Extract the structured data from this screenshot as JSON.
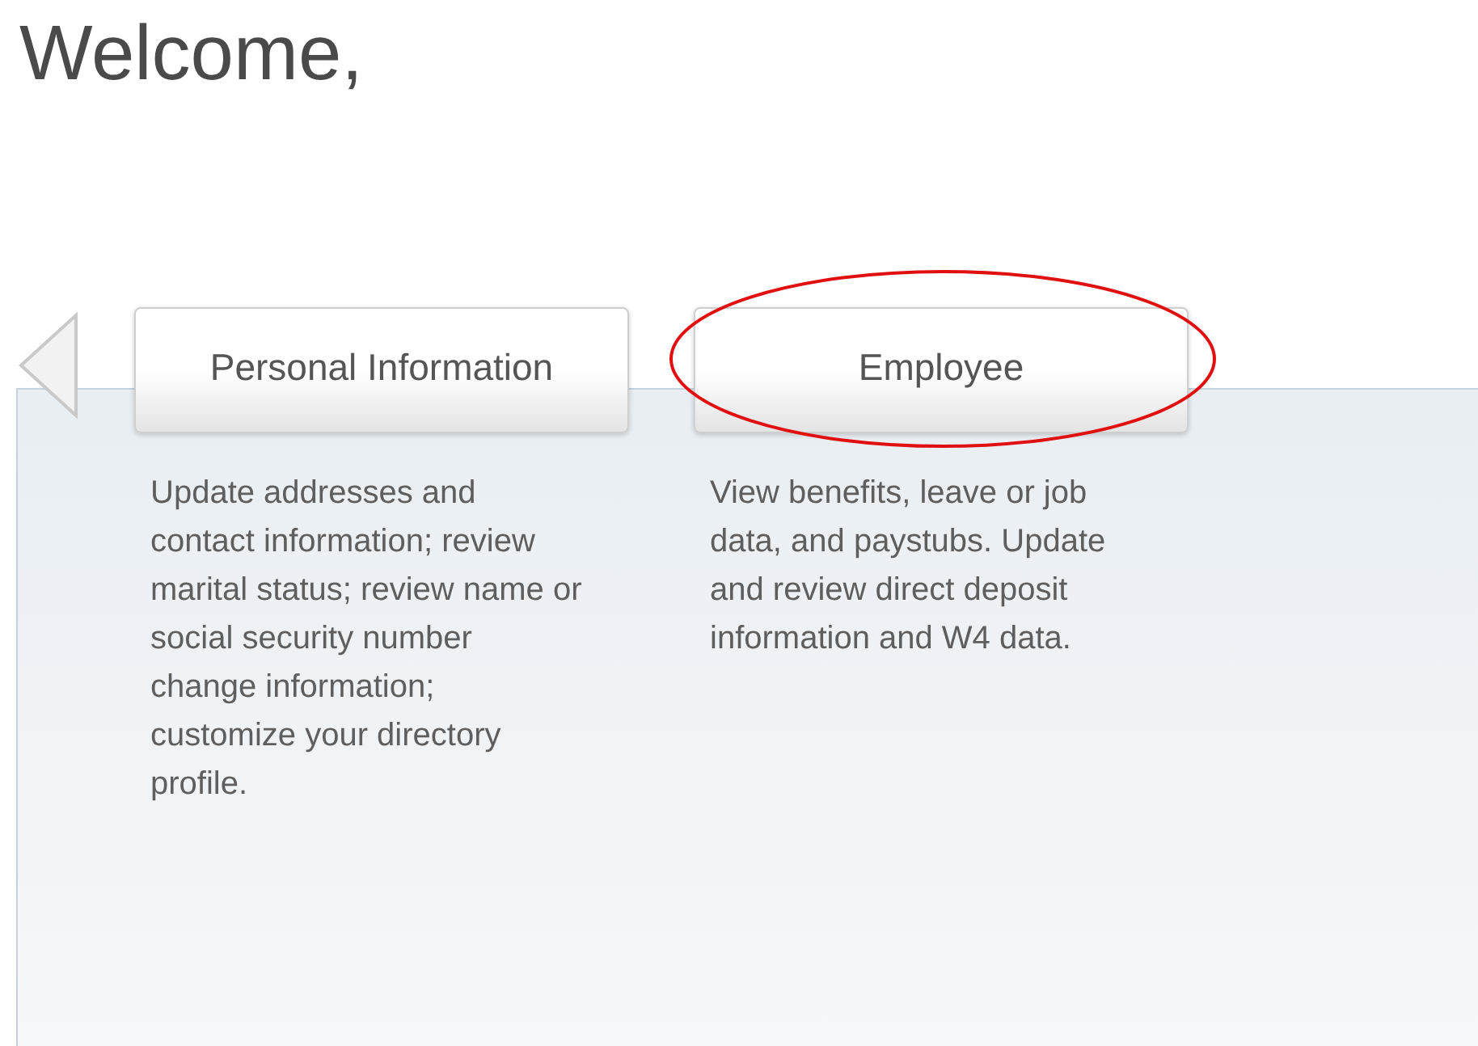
{
  "greeting": "Welcome,",
  "cards": [
    {
      "title": "Personal Information",
      "description": "Update addresses and contact information; review marital status; review name or social security number change information; customize your directory profile.",
      "highlighted": false
    },
    {
      "title": "Employee",
      "description": "View benefits, leave or job data, and paystubs. Update and review direct deposit information and W4 data.",
      "highlighted": true
    }
  ]
}
